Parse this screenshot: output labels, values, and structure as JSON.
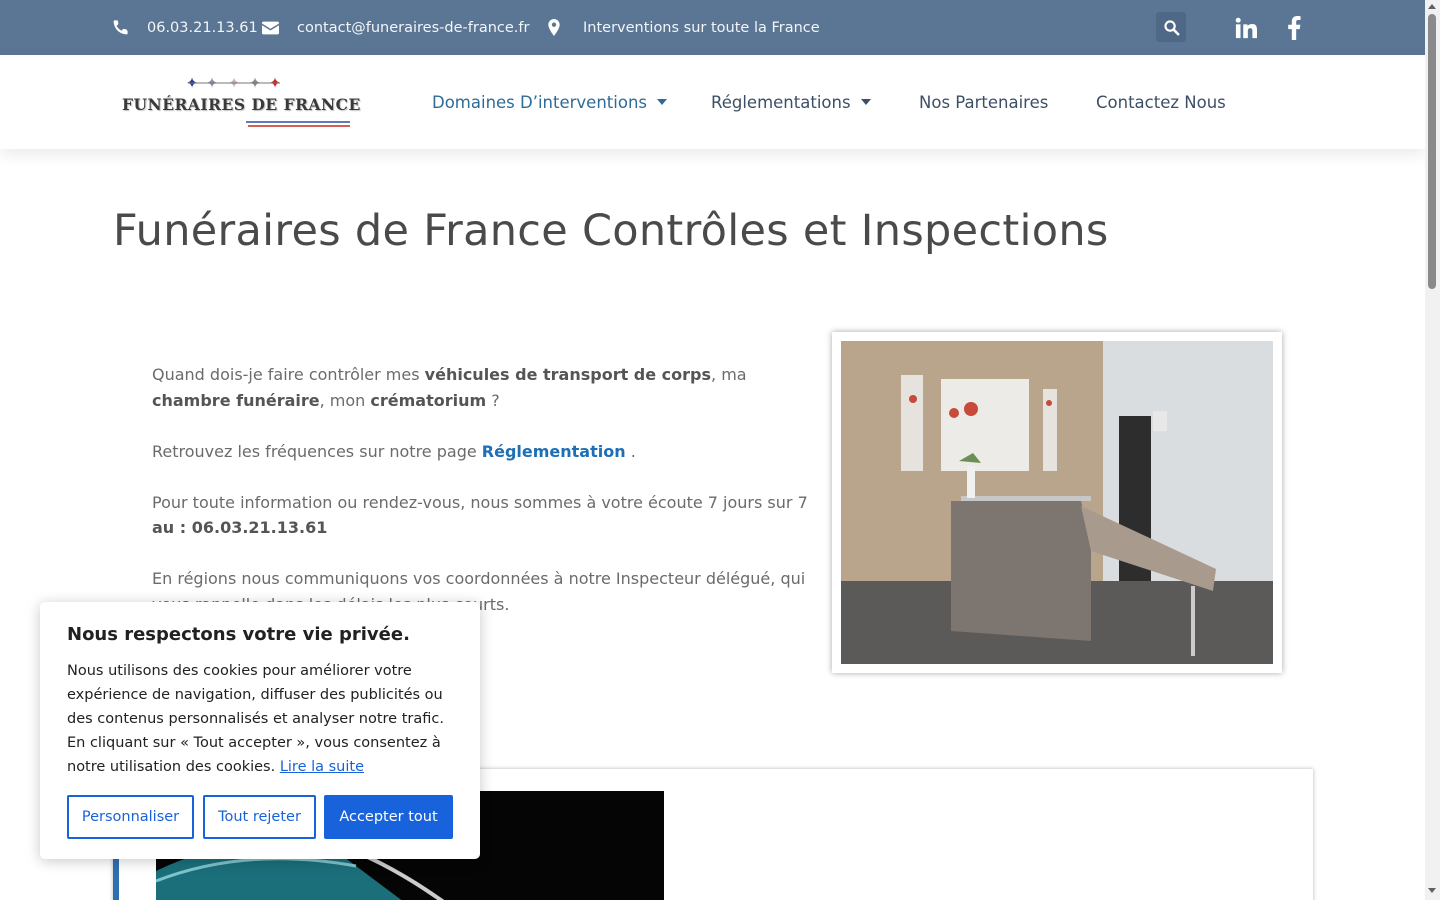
{
  "topbar": {
    "phone": "06.03.21.13.61",
    "email": "contact@funeraires-de-france.fr",
    "location": "Interventions sur toute la France"
  },
  "logo": {
    "text": "FUNÉRAIRES DE FRANCE"
  },
  "nav": {
    "items": [
      {
        "label": "Domaines D’interventions",
        "dropdown": true
      },
      {
        "label": "Réglementations",
        "dropdown": true
      },
      {
        "label": "Nos Partenaires",
        "dropdown": false
      },
      {
        "label": "Contactez Nous",
        "dropdown": false
      }
    ]
  },
  "page": {
    "title": "Funéraires de France Contrôles et Inspections"
  },
  "content": {
    "p1_a": "Quand dois-je faire contrôler mes ",
    "p1_b": "véhicules de transport de corps",
    "p1_c": ", ma ",
    "p1_d": "chambre funéraire",
    "p1_e": ", mon ",
    "p1_f": "crématorium",
    "p1_g": " ?",
    "p2_a": "Retrouvez les fréquences sur notre page ",
    "p2_link": "Réglementation",
    "p2_b": " .",
    "p3_a": "Pour toute information ou rendez-vous, nous sommes à votre écoute 7 jours sur 7 ",
    "p3_b": "au : 06.03.21.13.61",
    "p4": "En régions nous communiquons vos coordonnées à notre Inspecteur délégué, qui vous rappelle dans les délais les plus courts."
  },
  "cookie": {
    "title": "Nous respectons votre vie privée.",
    "text": "Nous utilisons des cookies pour améliorer votre expérience de navigation, diffuser des publicités ou des contenus personnalisés et analyser notre trafic. En cliquant sur « Tout accepter », vous consentez à notre utilisation des cookies.",
    "read_more": "Lire la suite",
    "customize": "Personnaliser",
    "reject": "Tout rejeter",
    "accept": "Accepter tout"
  },
  "colors": {
    "topbar": "#5b7694",
    "nav_active": "#2f6b97",
    "link": "#1e6fb5",
    "cookie_accent": "#1863dc"
  }
}
